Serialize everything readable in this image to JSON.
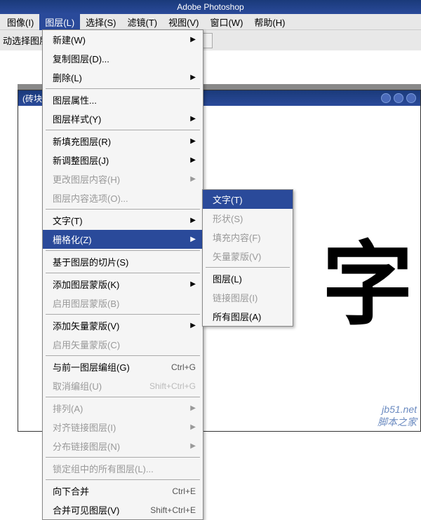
{
  "titlebar": "Adobe Photoshop",
  "menubar": [
    {
      "label": "图像(I)",
      "selected": false
    },
    {
      "label": "图层(L)",
      "selected": true
    },
    {
      "label": "选择(S)",
      "selected": false
    },
    {
      "label": "滤镜(T)",
      "selected": false
    },
    {
      "label": "视图(V)",
      "selected": false
    },
    {
      "label": "窗口(W)",
      "selected": false
    },
    {
      "label": "帮助(H)",
      "selected": false
    }
  ],
  "toolbar_label": "动选择图层",
  "doc_title": "(砖块文字, RGB)",
  "canvas_text": "字",
  "layer_menu": [
    {
      "type": "item",
      "label": "新建(W)",
      "arrow": true
    },
    {
      "type": "item",
      "label": "复制图层(D)..."
    },
    {
      "type": "item",
      "label": "删除(L)",
      "arrow": true
    },
    {
      "type": "sep"
    },
    {
      "type": "item",
      "label": "图层属性..."
    },
    {
      "type": "item",
      "label": "图层样式(Y)",
      "arrow": true
    },
    {
      "type": "sep"
    },
    {
      "type": "item",
      "label": "新填充图层(R)",
      "arrow": true
    },
    {
      "type": "item",
      "label": "新调整图层(J)",
      "arrow": true
    },
    {
      "type": "item",
      "label": "更改图层内容(H)",
      "disabled": true,
      "arrow": true
    },
    {
      "type": "item",
      "label": "图层内容选项(O)...",
      "disabled": true
    },
    {
      "type": "sep"
    },
    {
      "type": "item",
      "label": "文字(T)",
      "arrow": true
    },
    {
      "type": "item",
      "label": "栅格化(Z)",
      "arrow": true,
      "highlighted": true
    },
    {
      "type": "sep"
    },
    {
      "type": "item",
      "label": "基于图层的切片(S)"
    },
    {
      "type": "sep"
    },
    {
      "type": "item",
      "label": "添加图层蒙版(K)",
      "arrow": true
    },
    {
      "type": "item",
      "label": "启用图层蒙版(B)",
      "disabled": true
    },
    {
      "type": "sep"
    },
    {
      "type": "item",
      "label": "添加矢量蒙版(V)",
      "arrow": true
    },
    {
      "type": "item",
      "label": "启用矢量蒙版(C)",
      "disabled": true
    },
    {
      "type": "sep"
    },
    {
      "type": "item",
      "label": "与前一图层编组(G)",
      "shortcut": "Ctrl+G"
    },
    {
      "type": "item",
      "label": "取消编组(U)",
      "shortcut": "Shift+Ctrl+G",
      "disabled": true
    },
    {
      "type": "sep"
    },
    {
      "type": "item",
      "label": "排列(A)",
      "disabled": true,
      "arrow": true
    },
    {
      "type": "item",
      "label": "对齐链接图层(I)",
      "disabled": true,
      "arrow": true
    },
    {
      "type": "item",
      "label": "分布链接图层(N)",
      "disabled": true,
      "arrow": true
    },
    {
      "type": "sep"
    },
    {
      "type": "item",
      "label": "锁定组中的所有图层(L)...",
      "disabled": true
    },
    {
      "type": "sep"
    },
    {
      "type": "item",
      "label": "向下合并",
      "shortcut": "Ctrl+E"
    },
    {
      "type": "item",
      "label": "合并可见图层(V)",
      "shortcut": "Shift+Ctrl+E"
    }
  ],
  "rasterize_submenu": [
    {
      "type": "item",
      "label": "文字(T)",
      "highlighted": true
    },
    {
      "type": "item",
      "label": "形状(S)",
      "disabled": true
    },
    {
      "type": "item",
      "label": "填充内容(F)",
      "disabled": true
    },
    {
      "type": "item",
      "label": "矢量蒙版(V)",
      "disabled": true
    },
    {
      "type": "sep"
    },
    {
      "type": "item",
      "label": "图层(L)"
    },
    {
      "type": "item",
      "label": "链接图层(I)",
      "disabled": true
    },
    {
      "type": "item",
      "label": "所有图层(A)"
    }
  ],
  "watermark": {
    "line1": "jb51.net",
    "line2": "脚本之家"
  }
}
